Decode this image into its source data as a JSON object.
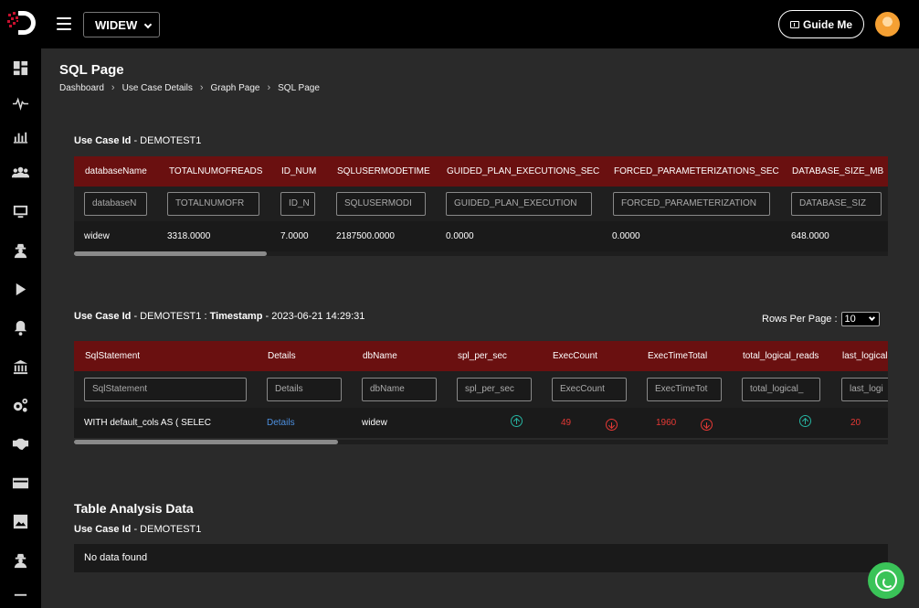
{
  "header": {
    "database_select": "WIDEW",
    "guide_button": "Guide Me"
  },
  "sidebar": {
    "icons": [
      "dashboard-icon",
      "pulse-icon",
      "bar-chart-icon",
      "users-icon",
      "monitor-icon",
      "agent-icon",
      "play-icon",
      "bell-icon",
      "bank-icon",
      "gears-icon",
      "handshake-icon",
      "credit-card-icon",
      "image-icon",
      "agent2-icon",
      "more-icon"
    ]
  },
  "page": {
    "title": "SQL Page",
    "breadcrumb": [
      "Dashboard",
      "Use Case Details",
      "Graph Page",
      "SQL Page"
    ]
  },
  "table1": {
    "caption_label": "Use Case Id",
    "caption_value": "- DEMOTEST1",
    "columns": [
      "databaseName",
      "TOTALNUMOFREADS",
      "ID_NUM",
      "SQLUSERMODETIME",
      "GUIDED_PLAN_EXECUTIONS_SEC",
      "FORCED_PARAMETERIZATIONS_SEC",
      "DATABASE_SIZE_MB"
    ],
    "filters": [
      "databaseN",
      "TOTALNUMOFR",
      "ID_N",
      "SQLUSERMODI",
      "GUIDED_PLAN_EXECUTION",
      "FORCED_PARAMETERIZATION",
      "DATABASE_SIZ"
    ],
    "row": [
      "widew",
      "3318.0000",
      "7.0000",
      "2187500.0000",
      "0.0000",
      "0.0000",
      "648.0000"
    ]
  },
  "table2": {
    "caption_label": "Use Case Id",
    "caption_value": "- DEMOTEST1 :",
    "timestamp_label": "Timestamp",
    "timestamp_value": "- 2023-06-21 14:29:31",
    "rows_per_page_label": "Rows Per Page :",
    "rows_per_page_value": "10",
    "columns": [
      "SqlStatement",
      "Details",
      "dbName",
      "spl_per_sec",
      "ExecCount",
      "ExecTimeTotal",
      "total_logical_reads",
      "last_logical"
    ],
    "filters": [
      "SqlStatement",
      "Details",
      "dbName",
      "spl_per_sec",
      "ExecCount",
      "ExecTimeTot",
      "total_logical_",
      "last_logi"
    ],
    "row": {
      "sql": "WITH default_cols AS ( SELEC",
      "details": "Details",
      "db": "widew",
      "exec_count": "49",
      "exec_time_total": "1960",
      "last_logical": "20"
    }
  },
  "table_analysis": {
    "title": "Table Analysis Data",
    "caption_label": "Use Case Id",
    "caption_value": "- DEMOTEST1",
    "empty_message": "No data found"
  }
}
